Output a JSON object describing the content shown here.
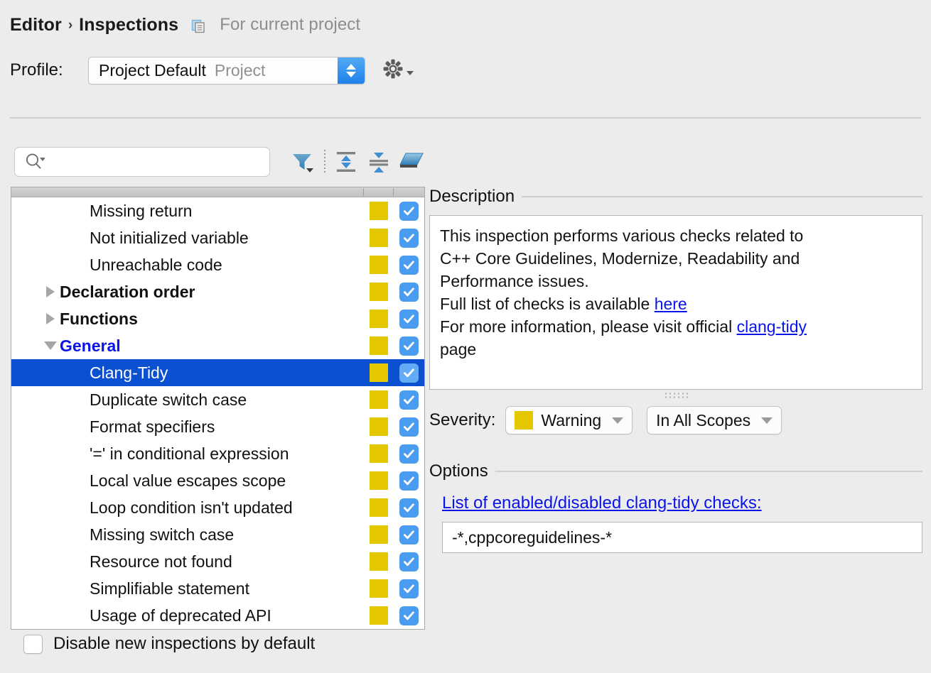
{
  "header": {
    "crumb_root": "Editor",
    "crumb_sep": "›",
    "crumb_current": "Inspections",
    "scope_note": "For current project",
    "copy_icon": "copy-documents-icon"
  },
  "profile": {
    "label": "Profile:",
    "value": "Project Default",
    "scope": "Project",
    "gear_icon": "gear-icon",
    "stepper_icon": "updown-stepper-icon"
  },
  "toolbar": {
    "search_placeholder": "",
    "search_value": "",
    "search_icon": "search-icon",
    "filter_icon": "filter-funnel-icon",
    "expand_all_icon": "expand-all-icon",
    "collapse_all_icon": "collapse-all-icon",
    "reset_icon": "eraser-reset-icon"
  },
  "tree": {
    "rows": [
      {
        "label": "Missing return",
        "indent": 3,
        "twisty": "none",
        "style": "normal",
        "severity_color": "#e5c700",
        "checked": true,
        "selected": false
      },
      {
        "label": "Not initialized variable",
        "indent": 3,
        "twisty": "none",
        "style": "normal",
        "severity_color": "#e5c700",
        "checked": true,
        "selected": false
      },
      {
        "label": "Unreachable code",
        "indent": 3,
        "twisty": "none",
        "style": "normal",
        "severity_color": "#e5c700",
        "checked": true,
        "selected": false
      },
      {
        "label": "Declaration order",
        "indent": 2,
        "twisty": "collapsed",
        "style": "bold",
        "severity_color": "#e5c700",
        "checked": true,
        "selected": false
      },
      {
        "label": "Functions",
        "indent": 2,
        "twisty": "collapsed",
        "style": "bold",
        "severity_color": "#e5c700",
        "checked": true,
        "selected": false
      },
      {
        "label": "General",
        "indent": 2,
        "twisty": "expanded",
        "style": "bold-blue",
        "severity_color": "#e5c700",
        "checked": true,
        "selected": false
      },
      {
        "label": "Clang-Tidy",
        "indent": 3,
        "twisty": "none",
        "style": "normal",
        "severity_color": "#e5c700",
        "checked": true,
        "selected": true
      },
      {
        "label": "Duplicate switch case",
        "indent": 3,
        "twisty": "none",
        "style": "normal",
        "severity_color": "#e5c700",
        "checked": true,
        "selected": false
      },
      {
        "label": "Format specifiers",
        "indent": 3,
        "twisty": "none",
        "style": "normal",
        "severity_color": "#e5c700",
        "checked": true,
        "selected": false
      },
      {
        "label": "'=' in conditional expression",
        "indent": 3,
        "twisty": "none",
        "style": "normal",
        "severity_color": "#e5c700",
        "checked": true,
        "selected": false
      },
      {
        "label": "Local value escapes scope",
        "indent": 3,
        "twisty": "none",
        "style": "normal",
        "severity_color": "#e5c700",
        "checked": true,
        "selected": false
      },
      {
        "label": "Loop condition isn't updated",
        "indent": 3,
        "twisty": "none",
        "style": "normal",
        "severity_color": "#e5c700",
        "checked": true,
        "selected": false
      },
      {
        "label": "Missing switch case",
        "indent": 3,
        "twisty": "none",
        "style": "normal",
        "severity_color": "#e5c700",
        "checked": true,
        "selected": false
      },
      {
        "label": "Resource not found",
        "indent": 3,
        "twisty": "none",
        "style": "normal",
        "severity_color": "#e5c700",
        "checked": true,
        "selected": false
      },
      {
        "label": "Simplifiable statement",
        "indent": 3,
        "twisty": "none",
        "style": "normal",
        "severity_color": "#e5c700",
        "checked": true,
        "selected": false
      },
      {
        "label": "Usage of deprecated API",
        "indent": 3,
        "twisty": "none",
        "style": "normal",
        "severity_color": "#e5c700",
        "checked": true,
        "selected": false
      }
    ]
  },
  "bottom": {
    "disable_new_label": "Disable new inspections by default",
    "disable_new_checked": false
  },
  "description": {
    "section_title": "Description",
    "line1": "This inspection performs various checks related to",
    "line2": "C++ Core Guidelines, Modernize, Readability and",
    "line3": "Performance issues.",
    "line4_pre": "Full list of checks is available ",
    "line4_link": "here",
    "line5_pre": "For more information, please visit official ",
    "line5_link": "clang-tidy",
    "line6": "page"
  },
  "severity": {
    "label": "Severity:",
    "value": "Warning",
    "swatch_color": "#e5c700",
    "scope_value": "In All Scopes"
  },
  "options": {
    "section_title": "Options",
    "link_label": "List of enabled/disabled clang-tidy checks:",
    "input_value": "-*,cppcoreguidelines-*"
  },
  "colors": {
    "background": "#ececec",
    "selection_blue": "#0b50d0",
    "checkbox_blue": "#4a9cf0",
    "warning_yellow": "#e5c700",
    "link_blue": "#0a14e8"
  }
}
